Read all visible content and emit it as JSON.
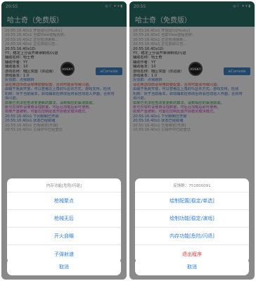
{
  "colors": {
    "appbar": "#2a6f68",
    "accent_blue": "#2f7fd8",
    "danger_red": "#e23b3b",
    "log_gray": "#9a9a9a",
    "log_dark": "#333333",
    "log_green": "#2e9d3f",
    "log_red": "#d64545",
    "log_blue": "#3b6fd0",
    "log_magenta": "#c542c5"
  },
  "left": {
    "status": {
      "time": "20:55",
      "icons": "◎ ☾ ✦ ▾ ▮"
    },
    "appbar_title": "哈士奇（免费版）",
    "float_logo": "HUSKY",
    "aconsole_label": "aConsole",
    "log_lines": [
      {
        "text": "20:55:16.4Dx1 开始运行[Husky]",
        "color": "#9a9a9a"
      },
      {
        "text": "20:55:16.4Dx1 当前View进程名称：",
        "color": "#9a9a9a"
      },
      {
        "text": "20:55:16.4Dx1 正在检测更新...",
        "color": "#9a9a9a"
      },
      {
        "text": "20:55:16.4Dx1 正在获取公告...",
        "color": "#9a9a9a"
      },
      {
        "text": "20:55:16.4Dx1D:",
        "color": "#333333"
      },
      {
        "text": "YY。稳定上分请开单续制购/闪退",
        "color": "#333333"
      },
      {
        "text": "辅助名称：哈士奇",
        "color": "#333333"
      },
      {
        "text": "辅助作者：YY",
        "color": "#333333"
      },
      {
        "text": "辅助版本：10",
        "color": "#333333"
      },
      {
        "text": "游戏名称：暗区突围（体验服）",
        "color": "#333333"
      },
      {
        "text": "游戏版本：1.0",
        "color": "#333333"
      },
      {
        "text": "反馈群：点我跳转",
        "color": "#3b6fd0"
      },
      {
        "text": "请在用选项前请常用前要配置，否则可能会导致闪退。",
        "color": "#d64545"
      },
      {
        "text": "由输于免费开放，可以查看左上角的%显示方式，游戏支持，检测",
        "color": "#3b6fd0"
      },
      {
        "text": "机制：对于当前版本，启动辅助在修改后将会自动进入界面，否则将",
        "color": "#3b6fd0"
      },
      {
        "text": "会闪退。",
        "color": "#3b6fd0"
      },
      {
        "text": "如果已无法检查改变更新的算法，请到相应的渠道获取。",
        "color": "#2e9d3f"
      },
      {
        "text": "账号异常时请使用清理数据，可后台加载后即可使用。",
        "color": "#c542c5"
      },
      {
        "text": "如果严重被制，可面在控制配置开启稳定模块模式。",
        "color": "#c542c5"
      },
      {
        "text": "20:55:16.4Dx1 下列制制已开启",
        "color": "#3b6fd0"
      },
      {
        "text": "20:55:16.4Dx1 状态已经就绪",
        "color": "#3b6fd0"
      },
      {
        "text": "20:55:16.4Dx1 已有绑定[开启]",
        "color": "#9a9a9a"
      },
      {
        "text": "20:55:16.4Dx1 以操作中已经登记",
        "color": "#9a9a9a"
      }
    ],
    "sheet": {
      "title": "内存功能[危险/闪退]",
      "items": [
        "枪械聚点",
        "枪械无后",
        "开火自瞄",
        "子弹射速"
      ]
    },
    "cancel": "取消"
  },
  "right": {
    "status": {
      "time": "20:55",
      "icons": "◎ ☾ ✦ ▾ ▮"
    },
    "appbar_title": "哈士奇（免费版）",
    "float_logo": "HUSKY",
    "aconsole_label": "aConsole",
    "log_lines": [
      {
        "text": "20:55:16.4Dx1 开始运行[Husky]",
        "color": "#9a9a9a"
      },
      {
        "text": "20:55:16.4Dx1 当前View进程名称：",
        "color": "#9a9a9a"
      },
      {
        "text": "20:55:16.4Dx1 正在检测更新...",
        "color": "#9a9a9a"
      },
      {
        "text": "20:55:16.4Dx1 正在获取公告...",
        "color": "#9a9a9a"
      },
      {
        "text": "20:55:16.4Dx1D:",
        "color": "#333333"
      },
      {
        "text": "YY。稳定上分请开单续制购/闪退",
        "color": "#333333"
      },
      {
        "text": "辅助名称：哈士奇",
        "color": "#333333"
      },
      {
        "text": "辅助作者：YY",
        "color": "#333333"
      },
      {
        "text": "辅助版本：10",
        "color": "#333333"
      },
      {
        "text": "游戏名称：暗区突围（体验服）",
        "color": "#333333"
      },
      {
        "text": "游戏版本：1.0",
        "color": "#333333"
      },
      {
        "text": "反馈群：点我跳转",
        "color": "#3b6fd0"
      },
      {
        "text": "请在用选项前请常用前要配置，否则可能会导致闪退。",
        "color": "#d64545"
      },
      {
        "text": "由输于免费开放，可以查看左上角的%显示方式，游戏支持，检测",
        "color": "#3b6fd0"
      },
      {
        "text": "机制：对于当前版本，启动辅助在修改后将会自动进入界面，否则将",
        "color": "#3b6fd0"
      },
      {
        "text": "会闪退。",
        "color": "#3b6fd0"
      },
      {
        "text": "如果已无法检查改变更新的算法，请到相应的渠道获取。",
        "color": "#2e9d3f"
      },
      {
        "text": "账号异常时请使用清理数据，可后台加载后即可使用。",
        "color": "#c542c5"
      },
      {
        "text": "如果严重被制，可面在控制配置开启稳定模块模式。",
        "color": "#c542c5"
      },
      {
        "text": "20:55:16.4Dx1 下列制制已开启",
        "color": "#3b6fd0"
      },
      {
        "text": "20:55:16.4Dx1 状态已经就绪",
        "color": "#3b6fd0"
      },
      {
        "text": "20:55:16.4Dx1 已有绑定[开启]",
        "color": "#9a9a9a"
      },
      {
        "text": "20:55:16.4Dx1 以操作中已经登记",
        "color": "#9a9a9a"
      }
    ],
    "sheet": {
      "title": "反馈群：751800091",
      "items": [
        "绘制配置[稳定/单选]",
        "绘制功能[稳定/演戏]",
        "内存功能[危险/闪退]"
      ],
      "danger_item": "退出程序"
    },
    "cancel": "取消"
  }
}
